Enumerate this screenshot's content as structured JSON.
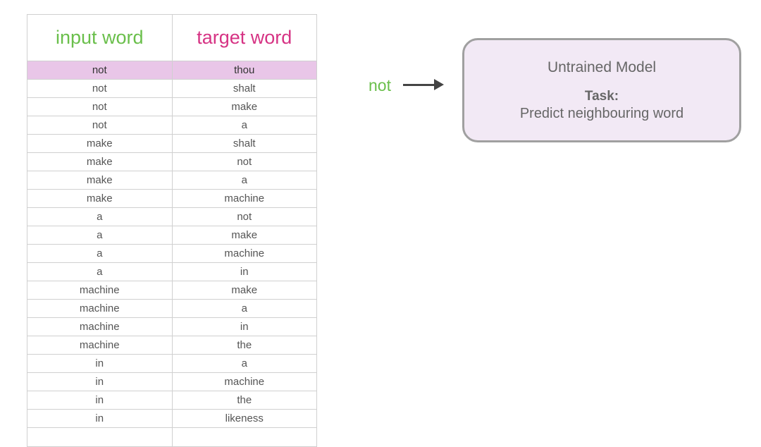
{
  "table": {
    "header_left": "input word",
    "header_right": "target word",
    "rows": [
      {
        "input": "not",
        "target": "thou",
        "highlighted": true
      },
      {
        "input": "not",
        "target": "shalt",
        "highlighted": false
      },
      {
        "input": "not",
        "target": "make",
        "highlighted": false
      },
      {
        "input": "not",
        "target": "a",
        "highlighted": false
      },
      {
        "input": "make",
        "target": "shalt",
        "highlighted": false
      },
      {
        "input": "make",
        "target": "not",
        "highlighted": false
      },
      {
        "input": "make",
        "target": "a",
        "highlighted": false
      },
      {
        "input": "make",
        "target": "machine",
        "highlighted": false
      },
      {
        "input": "a",
        "target": "not",
        "highlighted": false
      },
      {
        "input": "a",
        "target": "make",
        "highlighted": false
      },
      {
        "input": "a",
        "target": "machine",
        "highlighted": false
      },
      {
        "input": "a",
        "target": "in",
        "highlighted": false
      },
      {
        "input": "machine",
        "target": "make",
        "highlighted": false
      },
      {
        "input": "machine",
        "target": "a",
        "highlighted": false
      },
      {
        "input": "machine",
        "target": "in",
        "highlighted": false
      },
      {
        "input": "machine",
        "target": "the",
        "highlighted": false
      },
      {
        "input": "in",
        "target": "a",
        "highlighted": false
      },
      {
        "input": "in",
        "target": "machine",
        "highlighted": false
      },
      {
        "input": "in",
        "target": "the",
        "highlighted": false
      },
      {
        "input": "in",
        "target": "likeness",
        "highlighted": false
      },
      {
        "input": "",
        "target": "",
        "highlighted": false
      }
    ]
  },
  "input_label": "not",
  "model": {
    "title": "Untrained Model",
    "task_label": "Task:",
    "task_desc": "Predict neighbouring word"
  }
}
